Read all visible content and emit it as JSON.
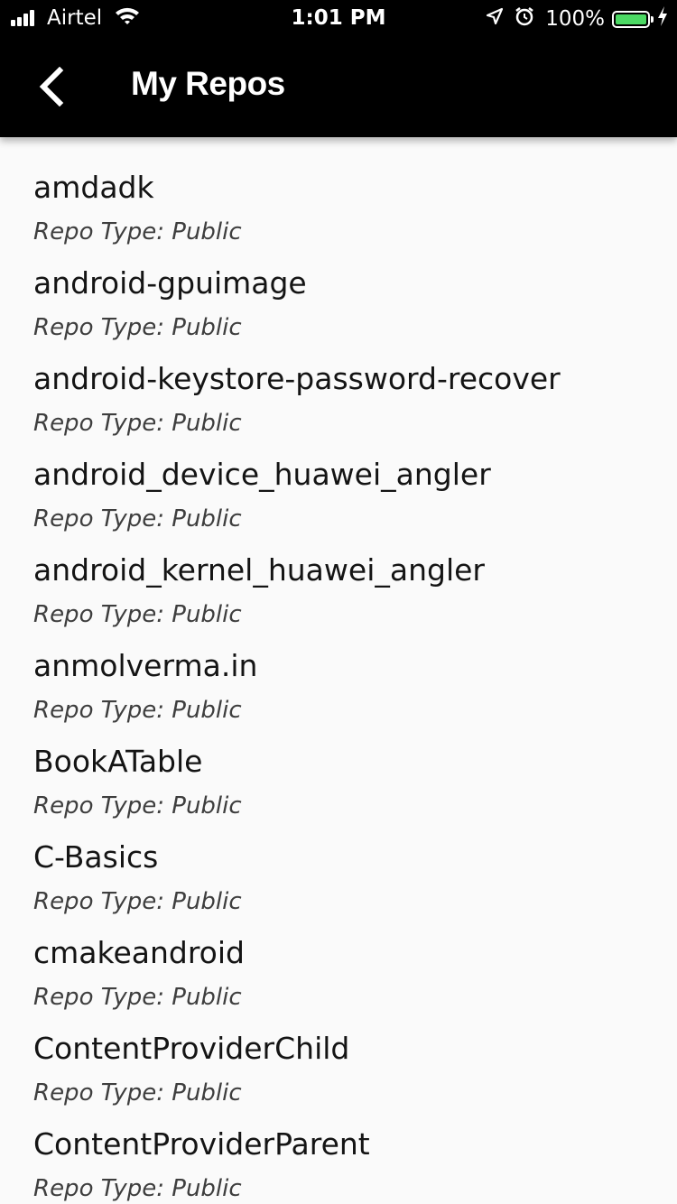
{
  "status_bar": {
    "carrier": "Airtel",
    "time": "1:01 PM",
    "battery_percent": "100%",
    "battery_level": 1.0,
    "battery_color": "#4cd964",
    "signal_bars": 4,
    "icons": [
      "signal-icon",
      "wifi-icon",
      "location-icon",
      "alarm-icon",
      "battery-icon",
      "charging-icon"
    ]
  },
  "header": {
    "title": "My Repos",
    "back_icon": "chevron-left-icon",
    "background": "#000000"
  },
  "repos": [
    {
      "name": "amdadk",
      "type": "Repo Type: Public"
    },
    {
      "name": "android-gpuimage",
      "type": "Repo Type: Public"
    },
    {
      "name": "android-keystore-password-recover",
      "type": "Repo Type: Public"
    },
    {
      "name": "android_device_huawei_angler",
      "type": "Repo Type: Public"
    },
    {
      "name": "android_kernel_huawei_angler",
      "type": "Repo Type: Public"
    },
    {
      "name": "anmolverma.in",
      "type": "Repo Type: Public"
    },
    {
      "name": "BookATable",
      "type": "Repo Type: Public"
    },
    {
      "name": "C-Basics",
      "type": "Repo Type: Public"
    },
    {
      "name": "cmakeandroid",
      "type": "Repo Type: Public"
    },
    {
      "name": "ContentProviderChild",
      "type": "Repo Type: Public"
    },
    {
      "name": "ContentProviderParent",
      "type": "Repo Type: Public"
    }
  ]
}
